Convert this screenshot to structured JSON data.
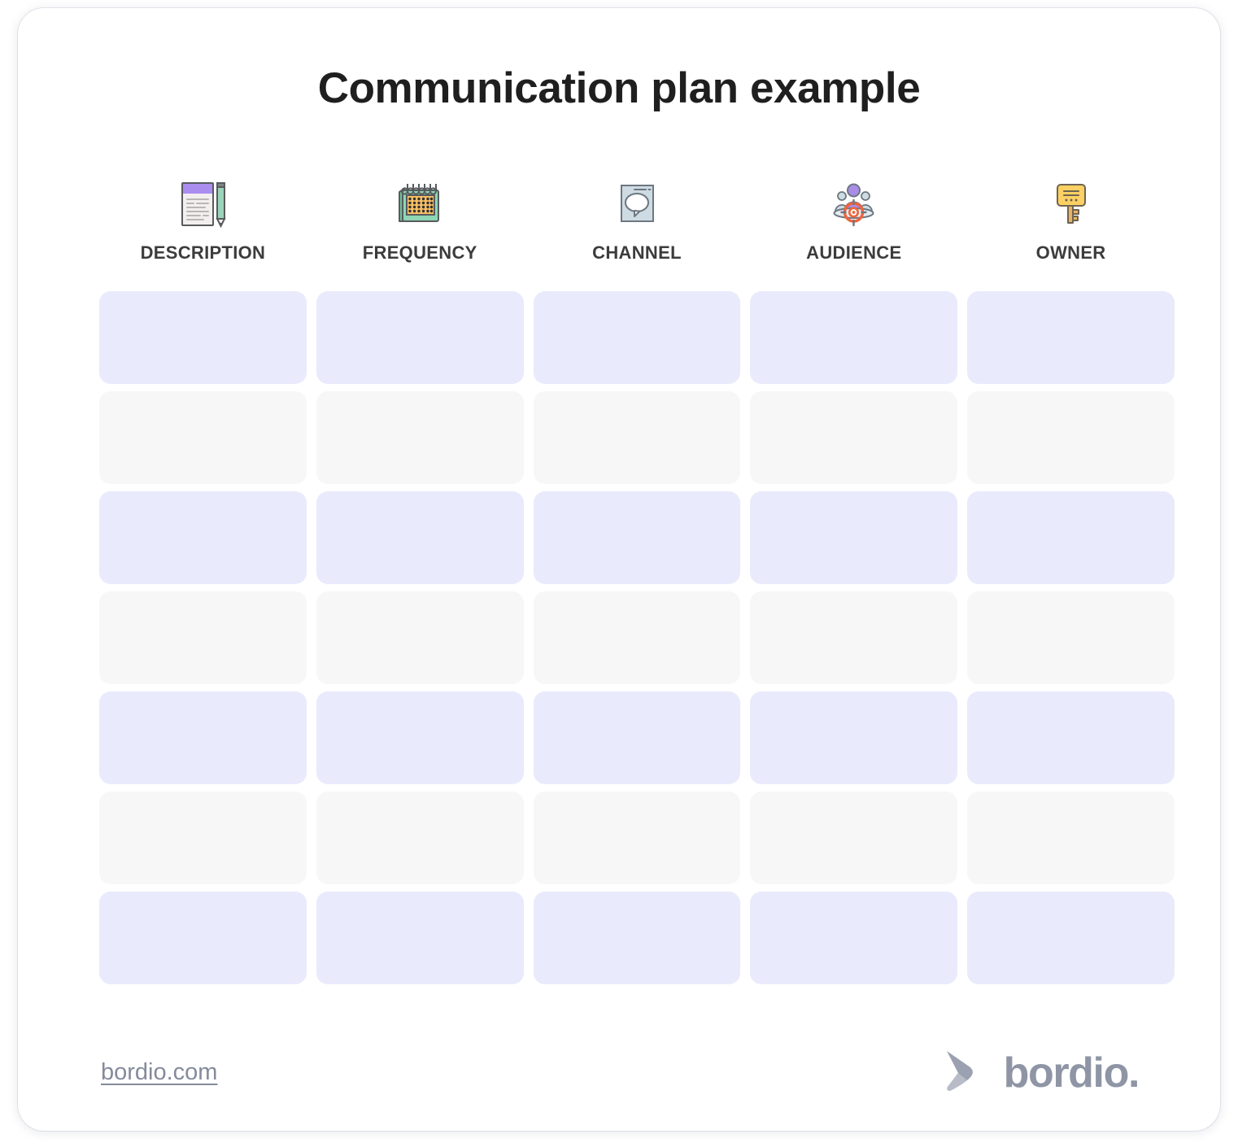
{
  "page": {
    "title": "Communication plan example",
    "background": "#ffffff",
    "card_background": "#ffffff"
  },
  "columns": [
    {
      "label": "DESCRIPTION",
      "icon": "document-pencil-icon"
    },
    {
      "label": "FREQUENCY",
      "icon": "calendar-icon"
    },
    {
      "label": "CHANNEL",
      "icon": "speech-bubble-screen-icon"
    },
    {
      "label": "AUDIENCE",
      "icon": "people-target-icon"
    },
    {
      "label": "OWNER",
      "icon": "key-icon"
    }
  ],
  "table": {
    "row_count": 7,
    "column_count": 5,
    "row_fill_colors": [
      "#e9eafb",
      "#f7f7f8"
    ],
    "rows": [
      {
        "index": 1,
        "style": "accent",
        "cells": [
          "",
          "",
          "",
          "",
          ""
        ]
      },
      {
        "index": 2,
        "style": "plain",
        "cells": [
          "",
          "",
          "",
          "",
          ""
        ]
      },
      {
        "index": 3,
        "style": "accent",
        "cells": [
          "",
          "",
          "",
          "",
          ""
        ]
      },
      {
        "index": 4,
        "style": "plain",
        "cells": [
          "",
          "",
          "",
          "",
          ""
        ]
      },
      {
        "index": 5,
        "style": "accent",
        "cells": [
          "",
          "",
          "",
          "",
          ""
        ]
      },
      {
        "index": 6,
        "style": "plain",
        "cells": [
          "",
          "",
          "",
          "",
          ""
        ]
      },
      {
        "index": 7,
        "style": "accent",
        "cells": [
          "",
          "",
          "",
          "",
          ""
        ]
      }
    ]
  },
  "footer": {
    "link_text": "bordio.com",
    "link_color": "#858b9c",
    "logo_text": "bordio.",
    "logo_color": "#8f95a5",
    "logo_mark": "bordio-swoosh-icon"
  },
  "colors": {
    "title": "#1f1f1f",
    "header_label": "#3c3c3c",
    "accent_row": "#e9eafb",
    "plain_row": "#f7f7f8"
  }
}
